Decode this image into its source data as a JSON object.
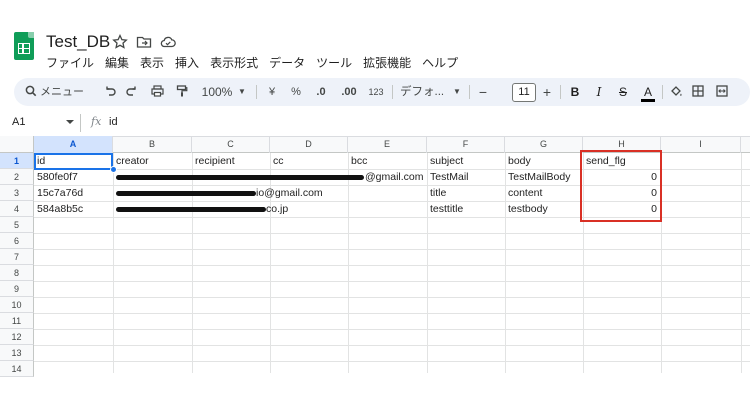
{
  "app": {
    "title": "Test_DB",
    "brand_color": "#0f9d58"
  },
  "menu": [
    "ファイル",
    "編集",
    "表示",
    "挿入",
    "表示形式",
    "データ",
    "ツール",
    "拡張機能",
    "ヘルプ"
  ],
  "toolbar": {
    "search_label": "メニュー",
    "zoom": "100%",
    "currency": "¥",
    "percent": "%",
    "decrease_decimal": ".0",
    "increase_decimal": ".00",
    "number_format": "123",
    "font": "デフォ...",
    "font_size": "11",
    "minus": "−",
    "plus": "+",
    "bold": "B",
    "italic": "I",
    "strike": "S",
    "text_color": "A"
  },
  "formula_bar": {
    "cell_ref": "A1",
    "fx": "fx",
    "content": "id"
  },
  "grid": {
    "columns": [
      "A",
      "B",
      "C",
      "D",
      "E",
      "F",
      "G",
      "H",
      "I"
    ],
    "rows": [
      "1",
      "2",
      "3",
      "4",
      "5",
      "6",
      "7",
      "8",
      "9",
      "10",
      "11",
      "12",
      "13",
      "14"
    ],
    "header": [
      "id",
      "creator",
      "recipient",
      "cc",
      "bcc",
      "subject",
      "body",
      "send_flg"
    ],
    "data": [
      {
        "id": "580fe0f7",
        "creator_tail": "@gmail.com",
        "subject": "TestMail",
        "body": "TestMailBody",
        "send_flg": "0"
      },
      {
        "id": "15c7a76d",
        "creator_tail": "io@gmail.com",
        "subject": "title",
        "body": "content",
        "send_flg": "0"
      },
      {
        "id": "584a8b5c",
        "creator_tail": "co.jp",
        "subject": "testtitle",
        "body": "testbody",
        "send_flg": "0"
      }
    ]
  },
  "colors": {
    "selection": "#1a73e8",
    "highlight": "#d93025",
    "toolbar_bg": "#eef2f9"
  }
}
